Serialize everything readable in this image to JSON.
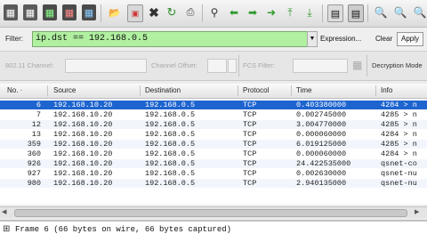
{
  "filter": {
    "label": "Filter:",
    "value": "ip.dst == 192.168.0.5",
    "expression_label": "Expression...",
    "clear_label": "Clear",
    "apply_label": "Apply",
    "valid_color": "#b0f0a0"
  },
  "wireless": {
    "channel_label": "802.11 Channel:",
    "offset_label": "Channel Offset:",
    "fcs_label": "FCS Filter:",
    "decryption_label": "Decryption Mode"
  },
  "columns": [
    "No. ·",
    "Source",
    "Destination",
    "Protocol",
    "Time",
    "Info"
  ],
  "packets": [
    {
      "no": "6",
      "src": "192.168.10.20",
      "dst": "192.168.0.5",
      "proto": "TCP",
      "time": "0.403380000",
      "info": "4284 > n",
      "selected": true
    },
    {
      "no": "7",
      "src": "192.168.10.20",
      "dst": "192.168.0.5",
      "proto": "TCP",
      "time": "0.002745000",
      "info": "4285 > n"
    },
    {
      "no": "12",
      "src": "192.168.10.20",
      "dst": "192.168.0.5",
      "proto": "TCP",
      "time": "3.004770000",
      "info": "4285 > n"
    },
    {
      "no": "13",
      "src": "192.168.10.20",
      "dst": "192.168.0.5",
      "proto": "TCP",
      "time": "0.000060000",
      "info": "4284 > n"
    },
    {
      "no": "359",
      "src": "192.168.10.20",
      "dst": "192.168.0.5",
      "proto": "TCP",
      "time": "6.019125000",
      "info": "4285 > n"
    },
    {
      "no": "360",
      "src": "192.168.10.20",
      "dst": "192.168.0.5",
      "proto": "TCP",
      "time": "0.000060000",
      "info": "4284 > n"
    },
    {
      "no": "926",
      "src": "192.168.10.20",
      "dst": "192.168.0.5",
      "proto": "TCP",
      "time": "24.422535000",
      "info": "qsnet-co"
    },
    {
      "no": "927",
      "src": "192.168.10.20",
      "dst": "192.168.0.5",
      "proto": "TCP",
      "time": "0.002630000",
      "info": "qsnet-nu"
    },
    {
      "no": "980",
      "src": "192.168.10.20",
      "dst": "192.168.0.5",
      "proto": "TCP",
      "time": "2.940135000",
      "info": "qsnet-nu"
    }
  ],
  "detail": {
    "line": "Frame 6 (66 bytes on wire, 66 bytes captured)",
    "toggle": "⊞"
  },
  "toolbar_icons": [
    "list-interfaces-icon",
    "capture-options-icon",
    "start-capture-icon",
    "stop-capture-icon",
    "restart-capture-icon",
    "open-file-icon",
    "save-file-icon",
    "close-file-icon",
    "reload-icon",
    "print-icon",
    "find-packet-icon",
    "go-back-icon",
    "go-forward-icon",
    "go-to-packet-icon",
    "go-first-icon",
    "go-last-icon",
    "colorize-icon",
    "autoscroll-icon",
    "zoom-in-icon",
    "zoom-out-icon"
  ]
}
